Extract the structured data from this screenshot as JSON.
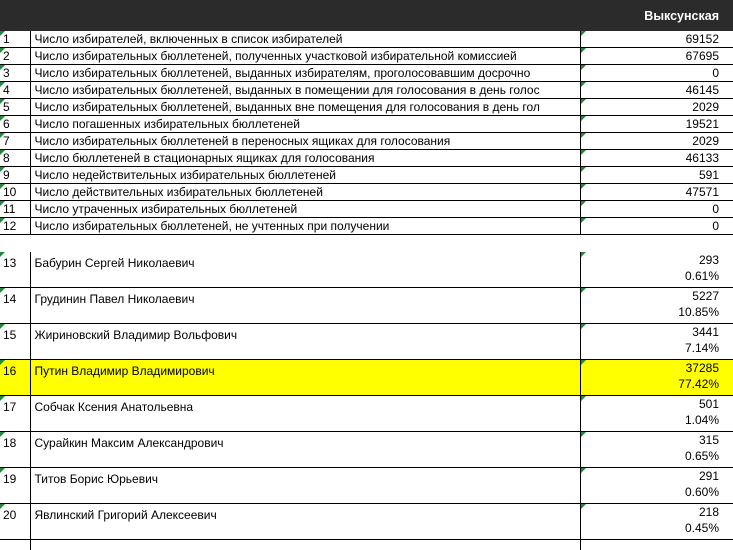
{
  "header": {
    "region": "Выксунская"
  },
  "protocol": [
    {
      "num": "1",
      "label": "Число избирателей, включенных в список избирателей",
      "value": "69152"
    },
    {
      "num": "2",
      "label": "Число избирательных бюллетеней, полученных участковой избирательной комиссией",
      "value": "67695"
    },
    {
      "num": "3",
      "label": "Число избирательных бюллетеней, выданных избирателям, проголосовавшим досрочно",
      "value": "0"
    },
    {
      "num": "4",
      "label": "Число избирательных бюллетеней, выданных в помещении для голосования в день голос",
      "value": "46145"
    },
    {
      "num": "5",
      "label": "Число избирательных бюллетеней, выданных вне помещения для голосования в день гол",
      "value": "2029"
    },
    {
      "num": "6",
      "label": "Число погашенных избирательных бюллетеней",
      "value": "19521"
    },
    {
      "num": "7",
      "label": "Число избирательных бюллетеней в переносных ящиках для голосования",
      "value": "2029"
    },
    {
      "num": "8",
      "label": "Число бюллетеней в стационарных ящиках для голосования",
      "value": "46133"
    },
    {
      "num": "9",
      "label": "Число недействительных избирательных бюллетеней",
      "value": "591"
    },
    {
      "num": "10",
      "label": "Число действительных избирательных бюллетеней",
      "value": "47571"
    },
    {
      "num": "11",
      "label": "Число утраченных избирательных бюллетеней",
      "value": "0"
    },
    {
      "num": "12",
      "label": "Число избирательных бюллетеней, не учтенных при получении",
      "value": "0"
    }
  ],
  "candidates": [
    {
      "num": "13",
      "name": "Бабурин Сергей Николаевич",
      "votes": "293",
      "pct": "0.61%"
    },
    {
      "num": "14",
      "name": "Грудинин Павел Николаевич",
      "votes": "5227",
      "pct": "10.85%"
    },
    {
      "num": "15",
      "name": "Жириновский Владимир Вольфович",
      "votes": "3441",
      "pct": "7.14%"
    },
    {
      "num": "16",
      "name": "Путин Владимир Владимирович",
      "votes": "37285",
      "pct": "77.42%",
      "highlight": true
    },
    {
      "num": "17",
      "name": "Собчак Ксения Анатольевна",
      "votes": "501",
      "pct": "1.04%"
    },
    {
      "num": "18",
      "name": "Сурайкин Максим Александрович",
      "votes": "315",
      "pct": "0.65%"
    },
    {
      "num": "19",
      "name": "Титов Борис Юрьевич",
      "votes": "291",
      "pct": "0.60%"
    },
    {
      "num": "20",
      "name": "Явлинский Григорий Алексеевич",
      "votes": "218",
      "pct": "0.45%"
    }
  ],
  "colors": {
    "header_bg": "#2b2b2b",
    "highlight": "#ffff00",
    "cell_marker": "#1f8a3b"
  }
}
